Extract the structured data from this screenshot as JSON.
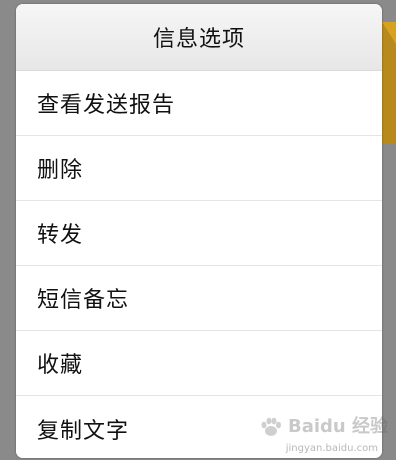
{
  "dialog": {
    "title": "信息选项",
    "items": [
      {
        "label": "查看发送报告"
      },
      {
        "label": "删除"
      },
      {
        "label": "转发"
      },
      {
        "label": "短信备忘"
      },
      {
        "label": "收藏"
      },
      {
        "label": "复制文字"
      }
    ]
  },
  "watermark": {
    "brand": "Baidu 经验",
    "url": "jingyan.baidu.com"
  },
  "colors": {
    "backdrop": "#8a8a8a",
    "accent": "#d7a21f"
  }
}
